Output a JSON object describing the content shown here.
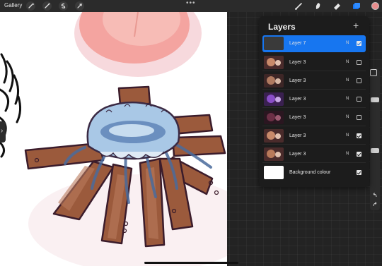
{
  "topbar": {
    "gallery_label": "Gallery",
    "more_label": "•••",
    "left_icons": [
      "wrench-icon",
      "magic-wand-icon",
      "selection-icon",
      "transform-icon"
    ],
    "tools": [
      "brush-icon",
      "smudge-icon",
      "eraser-icon",
      "layers-icon"
    ],
    "active_color": "#e88d8d"
  },
  "layers_panel": {
    "title": "Layers",
    "add_label": "+",
    "layers": [
      {
        "name": "Layer 7",
        "blend": "N",
        "visible": true,
        "selected": true
      },
      {
        "name": "Layer 3",
        "blend": "N",
        "visible": false,
        "selected": false
      },
      {
        "name": "Layer 3",
        "blend": "N",
        "visible": false,
        "selected": false
      },
      {
        "name": "Layer 3",
        "blend": "N",
        "visible": false,
        "selected": false
      },
      {
        "name": "Layer 3",
        "blend": "N",
        "visible": false,
        "selected": false
      },
      {
        "name": "Layer 3",
        "blend": "N",
        "visible": true,
        "selected": false
      },
      {
        "name": "Layer 3",
        "blend": "N",
        "visible": true,
        "selected": false
      },
      {
        "name": "Background colour",
        "blend": "",
        "visible": true,
        "selected": false
      }
    ]
  },
  "colors": {
    "accent": "#1776f0",
    "panel": "#1c1c1c"
  }
}
